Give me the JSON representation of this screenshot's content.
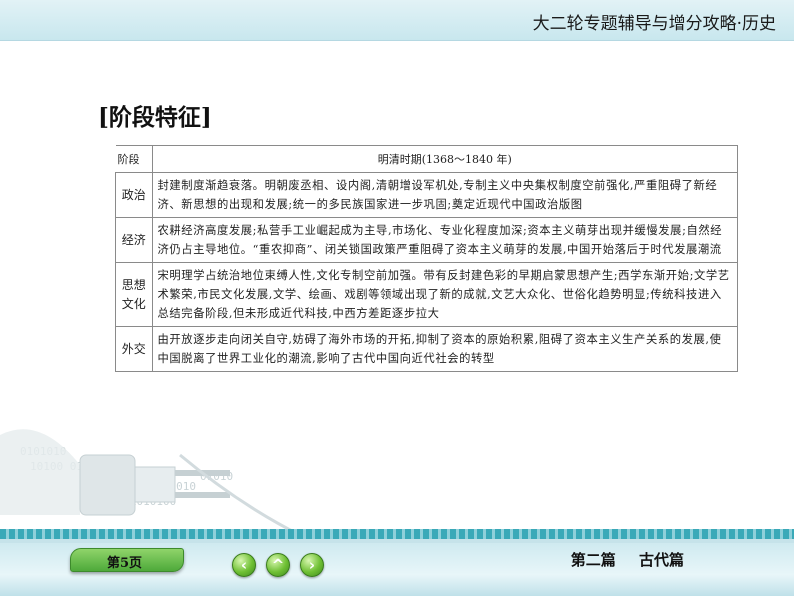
{
  "header": {
    "title": "大二轮专题辅导与增分攻略·历史"
  },
  "heading": "[阶段特征]",
  "table": {
    "col1_header": "阶段",
    "col2_header": "明清时期(1368～1840 年)",
    "rows": [
      {
        "category": "政治",
        "text": "封建制度渐趋衰落。明朝废丞相、设内阁,清朝增设军机处,专制主义中央集权制度空前强化,严重阻碍了新经济、新思想的出现和发展;统一的多民族国家进一步巩固;奠定近现代中国政治版图"
      },
      {
        "category": "经济",
        "text": "农耕经济高度发展;私营手工业崛起成为主导,市场化、专业化程度加深;资本主义萌芽出现并缓慢发展;自然经济仍占主导地位。“重农抑商”、闭关锁国政策严重阻碍了资本主义萌芽的发展,中国开始落后于时代发展潮流"
      },
      {
        "category": "思想文化",
        "text": "宋明理学占统治地位束缚人性,文化专制空前加强。带有反封建色彩的早期启蒙思想产生;西学东渐开始;文学艺术繁荣,市民文化发展,文学、绘画、戏剧等领域出现了新的成就,文艺大众化、世俗化趋势明显;传统科技进入总结完备阶段,但未形成近代科技,中西方差距逐步拉大"
      },
      {
        "category": "外交",
        "text": "由开放逐步走向闭关自守,妨碍了海外市场的开拓,抑制了资本的原始积累,阻碍了资本主义生产关系的发展,使中国脱离了世界工业化的潮流,影响了古代中国向近代社会的转型"
      }
    ]
  },
  "footer": {
    "page_label": "第5页",
    "prev_glyph": "‹",
    "up_glyph": "^",
    "next_glyph": "›",
    "section": "第二篇 古代篇"
  },
  "colors": {
    "accent": "#3aa9b8",
    "nav_green": "#6fc034"
  }
}
